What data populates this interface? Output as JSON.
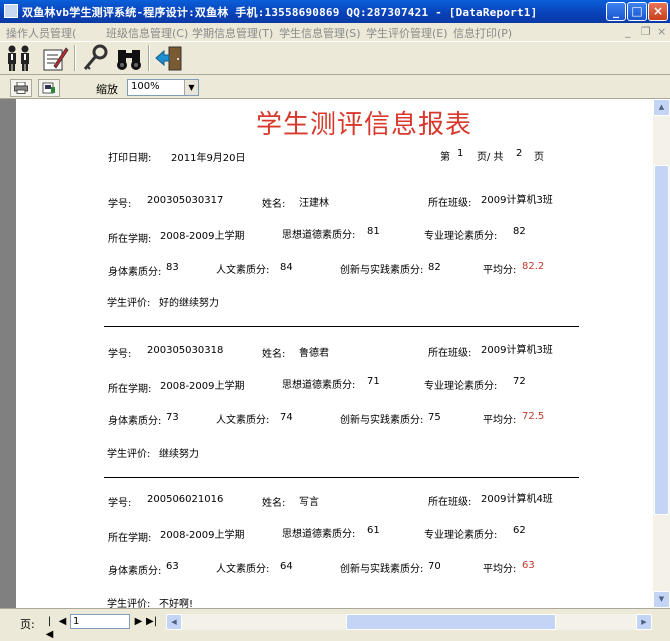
{
  "window": {
    "title": "双鱼林vb学生测评系统-程序设计:双鱼林 手机:13558690869 QQ:287307421 - [DataReport1]",
    "minimize": "_",
    "maximize": "□",
    "close": "×"
  },
  "menu": {
    "items": [
      "操作人员管理(",
      "班级信息管理(C)",
      "学期信息管理(T)",
      "学生信息管理(S)",
      "学生评价管理(E)",
      "信息打印(P)"
    ],
    "mdi_min": "_",
    "mdi_restore": "❐",
    "mdi_close": "×"
  },
  "toolbar": {
    "icons": [
      "users-icon",
      "edit-document-icon",
      "key-icon",
      "binoculars-icon",
      "exit-door-icon"
    ]
  },
  "report_toolbar": {
    "zoom_label": "缩放",
    "zoom_value": "100%"
  },
  "report": {
    "title": "学生测评信息报表",
    "print_date_label": "打印日期:",
    "print_date": "2011年9月20日",
    "page_info": {
      "prefix": "第",
      "current": "1",
      "middle": "页/ 共",
      "total": "2",
      "suffix": "页"
    },
    "labels": {
      "student_no": "学号:",
      "name": "姓名:",
      "class": "所在班级:",
      "term": "所在学期:",
      "moral": "思想道德素质分:",
      "professional": "专业理论素质分:",
      "physical": "身体素质分:",
      "humanity": "人文素质分:",
      "innovation": "创新与实践素质分:",
      "average": "平均分:",
      "evaluation": "学生评价:"
    },
    "records": [
      {
        "student_no": "200305030317",
        "name": "汪建林",
        "class": "2009计算机3班",
        "term": "2008-2009上学期",
        "moral": "81",
        "professional": "82",
        "physical": "83",
        "humanity": "84",
        "innovation": "82",
        "average": "82.2",
        "evaluation": "好的继续努力"
      },
      {
        "student_no": "200305030318",
        "name": "鲁德君",
        "class": "2009计算机3班",
        "term": "2008-2009上学期",
        "moral": "71",
        "professional": "72",
        "physical": "73",
        "humanity": "74",
        "innovation": "75",
        "average": "72.5",
        "evaluation": "继续努力"
      },
      {
        "student_no": "200506021016",
        "name": "写言",
        "class": "2009计算机4班",
        "term": "2008-2009上学期",
        "moral": "61",
        "professional": "62",
        "physical": "63",
        "humanity": "64",
        "innovation": "70",
        "average": "63",
        "evaluation": "不好啊!"
      }
    ]
  },
  "statusbar": {
    "page_label": "页:",
    "page_value": "1"
  }
}
